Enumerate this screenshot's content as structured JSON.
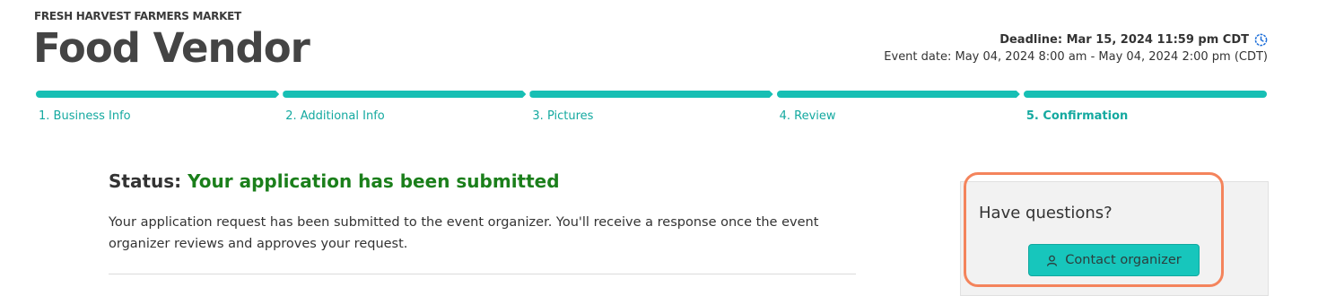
{
  "header": {
    "org_name": "FRESH HARVEST FARMERS MARKET",
    "title": "Food Vendor",
    "deadline": "Deadline: Mar 15, 2024 11:59 pm CDT",
    "event_date": "Event date: May 04, 2024 8:00 am - May 04, 2024 2:00 pm (CDT)",
    "deadline_icon": "clock-icon"
  },
  "steps": [
    {
      "label": "1. Business Info"
    },
    {
      "label": "2. Additional Info"
    },
    {
      "label": "3. Pictures"
    },
    {
      "label": "4. Review"
    },
    {
      "label": "5. Confirmation"
    }
  ],
  "current_step": 5,
  "status": {
    "prefix": "Status:",
    "value": "Your application has been submitted",
    "description": "Your application request has been submitted to the event organizer. You'll receive a response once the event organizer reviews and approves your request."
  },
  "help": {
    "title": "Have questions?",
    "contact_label": "Contact organizer",
    "contact_icon": "user-icon"
  },
  "colors": {
    "accent": "#17bfb4",
    "status_success": "#1b7f1b",
    "highlight": "#f4845c"
  }
}
